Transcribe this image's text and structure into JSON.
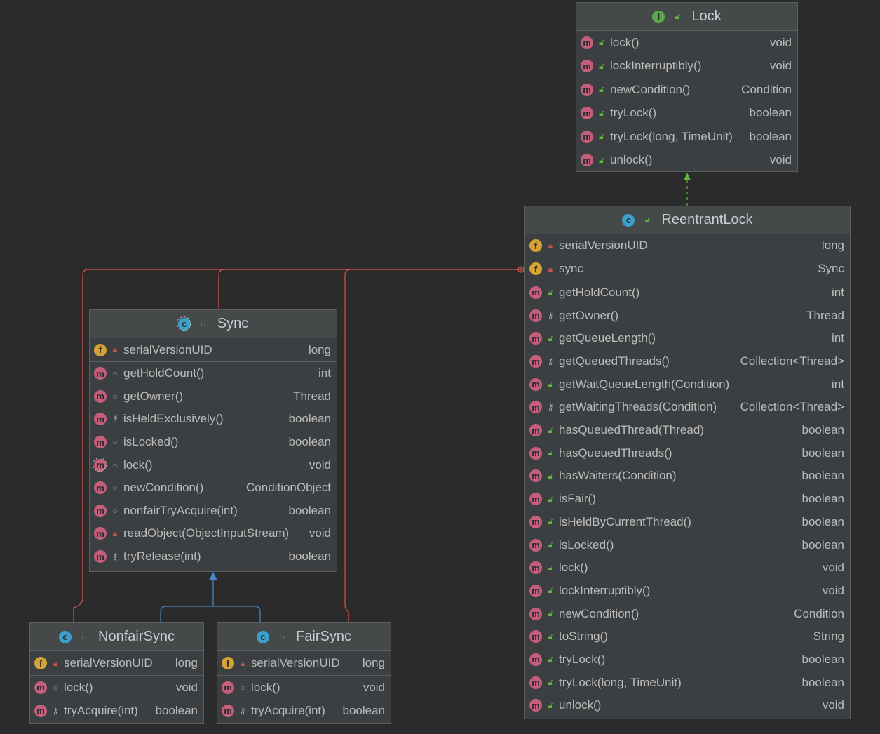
{
  "diagram": {
    "lock": {
      "title": "Lock",
      "kind": "interface",
      "members": [
        {
          "name": "lock()",
          "type": "void",
          "visibility": "public",
          "icon": "method-icon"
        },
        {
          "name": "lockInterruptibly()",
          "type": "void",
          "visibility": "public",
          "icon": "method-icon"
        },
        {
          "name": "newCondition()",
          "type": "Condition",
          "visibility": "public",
          "icon": "method-icon"
        },
        {
          "name": "tryLock()",
          "type": "boolean",
          "visibility": "public",
          "icon": "method-icon"
        },
        {
          "name": "tryLock(long, TimeUnit)",
          "type": "boolean",
          "visibility": "public",
          "icon": "method-icon"
        },
        {
          "name": "unlock()",
          "type": "void",
          "visibility": "public",
          "icon": "method-icon"
        }
      ]
    },
    "reentrant": {
      "title": "ReentrantLock",
      "kind": "class",
      "fields": [
        {
          "name": "serialVersionUID",
          "type": "long",
          "visibility": "private",
          "icon": "field-icon"
        },
        {
          "name": "sync",
          "type": "Sync",
          "visibility": "private",
          "icon": "field-icon"
        }
      ],
      "methods": [
        {
          "name": "getHoldCount()",
          "type": "int",
          "visibility": "public"
        },
        {
          "name": "getOwner()",
          "type": "Thread",
          "visibility": "protected"
        },
        {
          "name": "getQueueLength()",
          "type": "int",
          "visibility": "public"
        },
        {
          "name": "getQueuedThreads()",
          "type": "Collection<Thread>",
          "visibility": "protected"
        },
        {
          "name": "getWaitQueueLength(Condition)",
          "type": "int",
          "visibility": "public"
        },
        {
          "name": "getWaitingThreads(Condition)",
          "type": "Collection<Thread>",
          "visibility": "protected"
        },
        {
          "name": "hasQueuedThread(Thread)",
          "type": "boolean",
          "visibility": "public"
        },
        {
          "name": "hasQueuedThreads()",
          "type": "boolean",
          "visibility": "public"
        },
        {
          "name": "hasWaiters(Condition)",
          "type": "boolean",
          "visibility": "public"
        },
        {
          "name": "isFair()",
          "type": "boolean",
          "visibility": "public"
        },
        {
          "name": "isHeldByCurrentThread()",
          "type": "boolean",
          "visibility": "public"
        },
        {
          "name": "isLocked()",
          "type": "boolean",
          "visibility": "public"
        },
        {
          "name": "lock()",
          "type": "void",
          "visibility": "public"
        },
        {
          "name": "lockInterruptibly()",
          "type": "void",
          "visibility": "public"
        },
        {
          "name": "newCondition()",
          "type": "Condition",
          "visibility": "public"
        },
        {
          "name": "toString()",
          "type": "String",
          "visibility": "public"
        },
        {
          "name": "tryLock()",
          "type": "boolean",
          "visibility": "public"
        },
        {
          "name": "tryLock(long, TimeUnit)",
          "type": "boolean",
          "visibility": "public"
        },
        {
          "name": "unlock()",
          "type": "void",
          "visibility": "public"
        }
      ]
    },
    "sync": {
      "title": "Sync",
      "kind": "abstract class",
      "fields": [
        {
          "name": "serialVersionUID",
          "type": "long",
          "visibility": "private"
        }
      ],
      "methods": [
        {
          "name": "getHoldCount()",
          "type": "int",
          "visibility": "package"
        },
        {
          "name": "getOwner()",
          "type": "Thread",
          "visibility": "package"
        },
        {
          "name": "isHeldExclusively()",
          "type": "boolean",
          "visibility": "protected"
        },
        {
          "name": "isLocked()",
          "type": "boolean",
          "visibility": "package"
        },
        {
          "name": "lock()",
          "type": "void",
          "visibility": "package",
          "abstract": true
        },
        {
          "name": "newCondition()",
          "type": "ConditionObject",
          "visibility": "package"
        },
        {
          "name": "nonfairTryAcquire(int)",
          "type": "boolean",
          "visibility": "package"
        },
        {
          "name": "readObject(ObjectInputStream)",
          "type": "void",
          "visibility": "private"
        },
        {
          "name": "tryRelease(int)",
          "type": "boolean",
          "visibility": "protected"
        }
      ]
    },
    "nonfair": {
      "title": "NonfairSync",
      "kind": "class",
      "fields": [
        {
          "name": "serialVersionUID",
          "type": "long",
          "visibility": "private"
        }
      ],
      "methods": [
        {
          "name": "lock()",
          "type": "void",
          "visibility": "package"
        },
        {
          "name": "tryAcquire(int)",
          "type": "boolean",
          "visibility": "protected"
        }
      ]
    },
    "fair": {
      "title": "FairSync",
      "kind": "class",
      "fields": [
        {
          "name": "serialVersionUID",
          "type": "long",
          "visibility": "private"
        }
      ],
      "methods": [
        {
          "name": "lock()",
          "type": "void",
          "visibility": "package"
        },
        {
          "name": "tryAcquire(int)",
          "type": "boolean",
          "visibility": "protected"
        }
      ]
    }
  },
  "colors": {
    "background": "#2b2b2b",
    "box": "#3c3f41",
    "header": "#45494a",
    "inner_class_link": "#d9534f",
    "implements_link": "#62b543",
    "extends_link": "#4a88c7"
  }
}
